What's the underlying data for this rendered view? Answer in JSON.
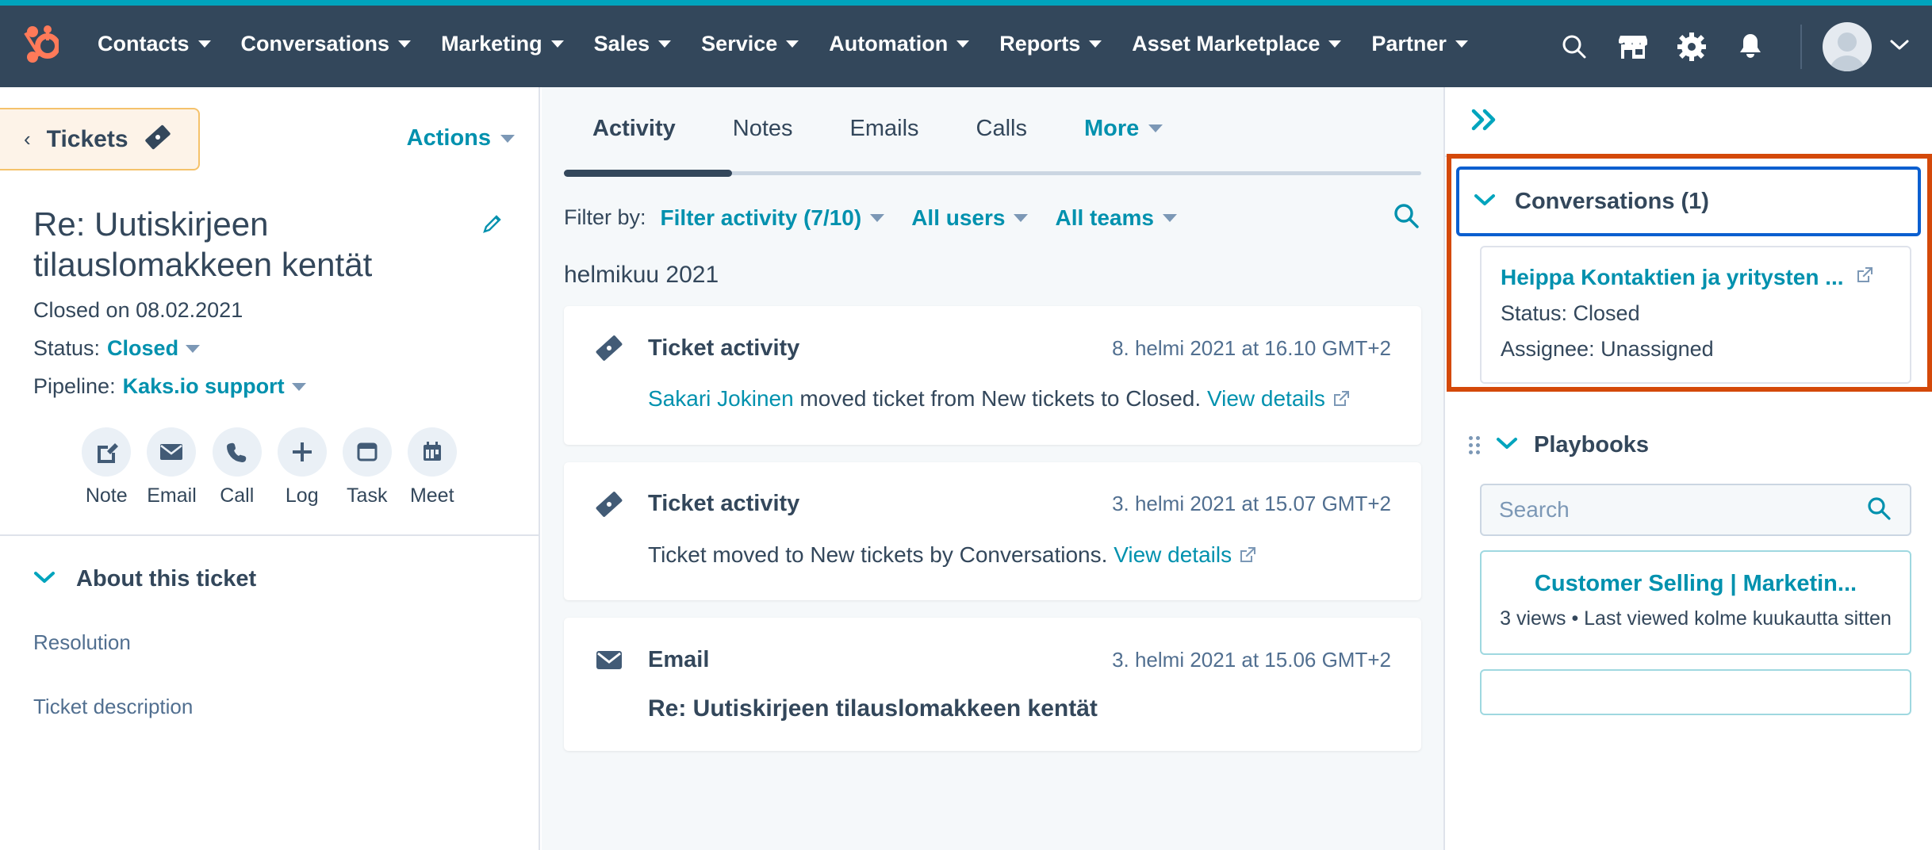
{
  "colors": {
    "nav_bg": "#33475b",
    "nav_accent": "#00a4bd",
    "brand_orange": "#ff7a59",
    "link_teal": "#0091ae",
    "highlight_orange": "#d4490a",
    "focus_blue": "#0b5fd0",
    "ticket_btn_bg": "#fdf3e8",
    "ticket_btn_border": "#f5c26b"
  },
  "topnav": {
    "logo_name": "hubspot-sprocket-logo",
    "items": [
      {
        "label": "Contacts"
      },
      {
        "label": "Conversations"
      },
      {
        "label": "Marketing"
      },
      {
        "label": "Sales"
      },
      {
        "label": "Service"
      },
      {
        "label": "Automation"
      },
      {
        "label": "Reports"
      },
      {
        "label": "Asset Marketplace"
      },
      {
        "label": "Partner"
      }
    ],
    "icons": [
      {
        "name": "search-icon"
      },
      {
        "name": "marketplace-icon"
      },
      {
        "name": "gear-icon"
      },
      {
        "name": "notifications-bell-icon"
      }
    ]
  },
  "left_panel": {
    "back_button": {
      "label": "Tickets",
      "chevron": "‹",
      "icon_name": "ticket-icon"
    },
    "actions_button": {
      "label": "Actions"
    },
    "ticket_title": "Re: Uutiskirjeen tilauslomakkeen kentät",
    "edit_icon_name": "pencil-icon",
    "closed_on": "Closed on 08.02.2021",
    "status_label": "Status:",
    "status_value": "Closed",
    "pipeline_label": "Pipeline:",
    "pipeline_value": "Kaks.io support",
    "quick_actions": [
      {
        "label": "Note",
        "icon": "note-icon"
      },
      {
        "label": "Email",
        "icon": "email-icon"
      },
      {
        "label": "Call",
        "icon": "phone-icon"
      },
      {
        "label": "Log",
        "icon": "plus-icon"
      },
      {
        "label": "Task",
        "icon": "task-icon"
      },
      {
        "label": "Meet",
        "icon": "calendar-icon"
      }
    ],
    "about_section": {
      "label": "About this ticket"
    },
    "properties": [
      {
        "label": "Resolution"
      },
      {
        "label": "Ticket description"
      }
    ]
  },
  "center_panel": {
    "tabs": [
      {
        "label": "Activity",
        "active": true
      },
      {
        "label": "Notes",
        "active": false
      },
      {
        "label": "Emails",
        "active": false
      },
      {
        "label": "Calls",
        "active": false
      },
      {
        "label": "More",
        "active": false,
        "has_caret": true
      }
    ],
    "filter_label": "Filter by:",
    "filters": [
      {
        "label": "Filter activity (7/10)"
      },
      {
        "label": "All users"
      },
      {
        "label": "All teams"
      }
    ],
    "search_icon_name": "activity-search-icon",
    "month_group": "helmikuu 2021",
    "activities": [
      {
        "type": "ticket",
        "icon": "ticket-icon",
        "title": "Ticket activity",
        "timestamp": "8. helmi 2021 at 16.10 GMT+2",
        "body_link_lead": "Sakari Jokinen",
        "body_text": " moved ticket from New tickets to Closed. ",
        "body_link_tail": "View details",
        "external_icon": "external-link-icon"
      },
      {
        "type": "ticket",
        "icon": "ticket-icon",
        "title": "Ticket activity",
        "timestamp": "3. helmi 2021 at 15.07 GMT+2",
        "body_link_lead": "",
        "body_text": "Ticket moved to New tickets by Conversations. ",
        "body_link_tail": "View details",
        "external_icon": "external-link-icon"
      },
      {
        "type": "email",
        "icon": "email-icon",
        "title": "Email",
        "timestamp": "3. helmi 2021 at 15.06 GMT+2",
        "subject": "Re: Uutiskirjeen tilauslomakkeen kentät"
      }
    ]
  },
  "right_panel": {
    "collapse_icon_name": "double-chevron-right-icon",
    "conversations": {
      "header": "Conversations (1)",
      "item": {
        "title": "Heippa Kontaktien ja yritysten ...",
        "external_icon": "external-link-icon",
        "status": "Status: Closed",
        "assignee": "Assignee: Unassigned"
      }
    },
    "playbooks": {
      "header": "Playbooks",
      "search_placeholder": "Search",
      "search_value": "",
      "cards": [
        {
          "title": "Customer Selling | Marketin...",
          "subtitle": "3 views • Last viewed kolme kuukautta sitten"
        }
      ]
    }
  }
}
